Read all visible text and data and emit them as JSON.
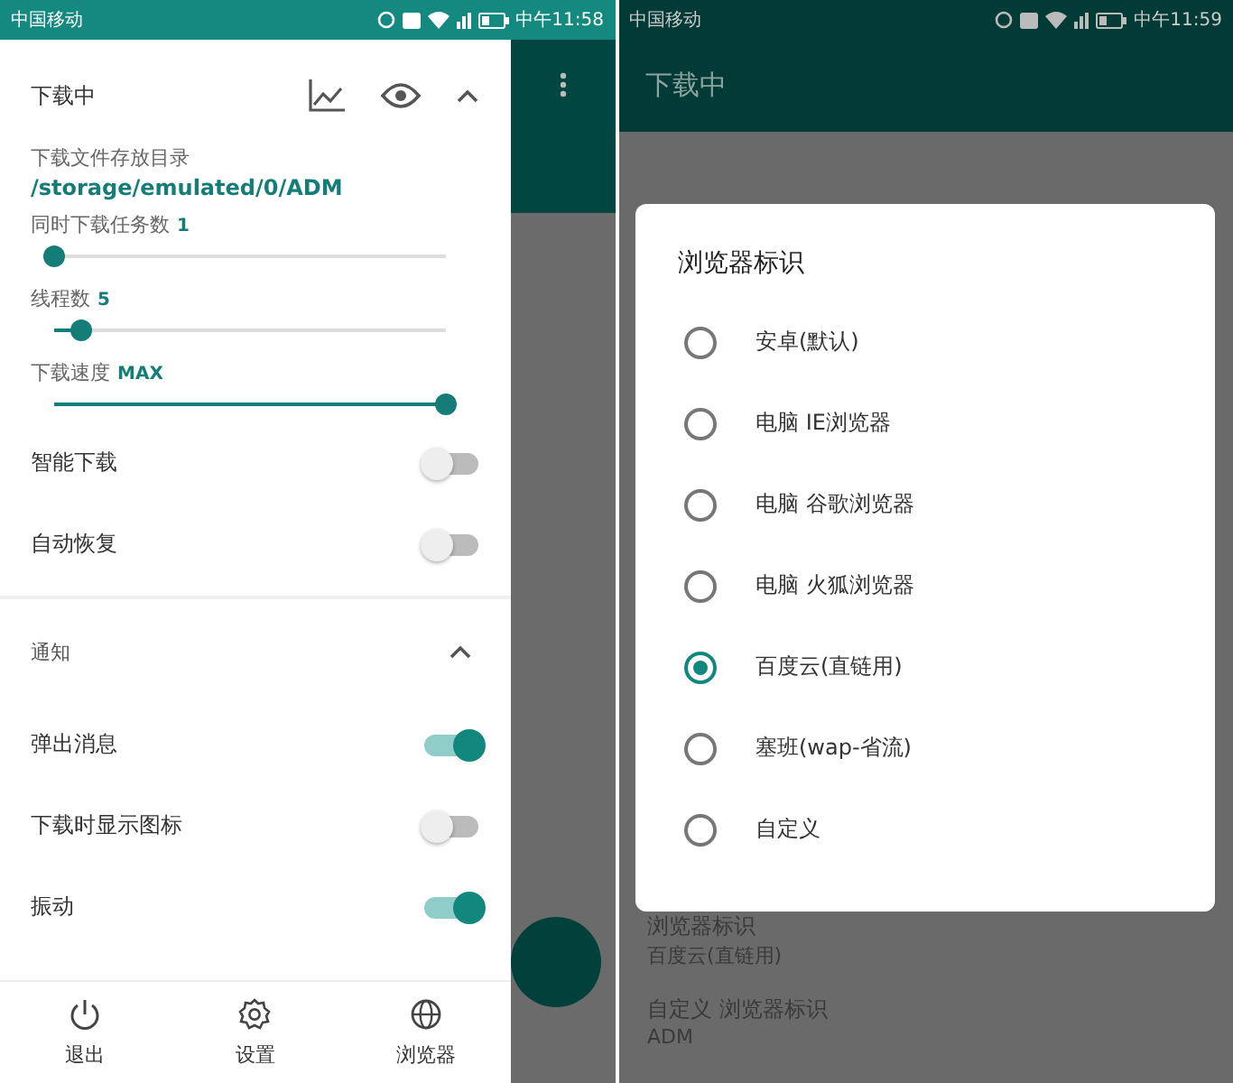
{
  "left_screen": {
    "status_bar": {
      "carrier": "中国移动",
      "time": "中午11:58"
    },
    "drawer": {
      "title": "下载中",
      "download_dir": {
        "label": "下载文件存放目录",
        "value": "/storage/emulated/0/ADM"
      },
      "sliders": [
        {
          "label": "同时下载任务数",
          "reading": "1",
          "level": 0
        },
        {
          "label": "线程数",
          "reading": "5",
          "level": 0.07
        },
        {
          "label": "下载速度",
          "reading": "MAX",
          "level": 1
        }
      ],
      "toggles": [
        {
          "label": "智能下载",
          "on": false
        },
        {
          "label": "自动恢复",
          "on": false
        }
      ],
      "notification_section": {
        "title": "通知",
        "toggles": [
          {
            "label": "弹出消息",
            "on": true
          },
          {
            "label": "下载时显示图标",
            "on": false
          },
          {
            "label": "振动",
            "on": true
          }
        ]
      },
      "bottom_nav": [
        {
          "kind": "power",
          "label": "退出"
        },
        {
          "kind": "gear",
          "label": "设置"
        },
        {
          "kind": "globe",
          "label": "浏览器"
        }
      ]
    }
  },
  "right_screen": {
    "status_bar": {
      "carrier": "中国移动",
      "time": "中午11:59"
    },
    "toolbar_title": "下载中",
    "dialog": {
      "title": "浏览器标识",
      "options": [
        {
          "label": "安卓(默认)",
          "selected": false
        },
        {
          "label": "电脑 IE浏览器",
          "selected": false
        },
        {
          "label": "电脑 谷歌浏览器",
          "selected": false
        },
        {
          "label": "电脑 火狐浏览器",
          "selected": false
        },
        {
          "label": "百度云(直链用)",
          "selected": true
        },
        {
          "label": "塞班(wap-省流)",
          "selected": false
        },
        {
          "label": "自定义",
          "selected": false
        }
      ]
    },
    "background_settings": [
      {
        "title": "浏览器标识",
        "value": "百度云(直链用)"
      },
      {
        "title": "自定义 浏览器标识",
        "value": "ADM"
      }
    ]
  }
}
